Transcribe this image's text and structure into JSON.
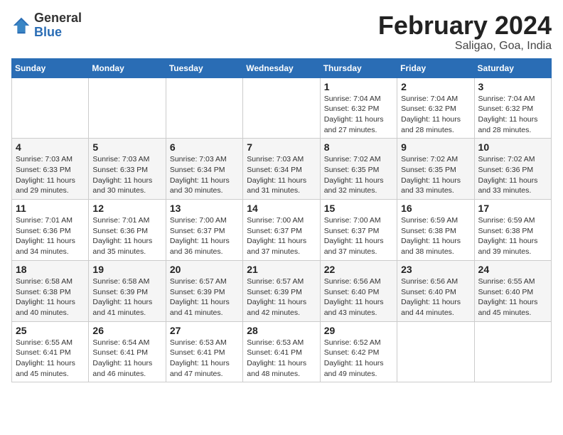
{
  "header": {
    "logo_general": "General",
    "logo_blue": "Blue",
    "month_title": "February 2024",
    "location": "Saligao, Goa, India"
  },
  "weekdays": [
    "Sunday",
    "Monday",
    "Tuesday",
    "Wednesday",
    "Thursday",
    "Friday",
    "Saturday"
  ],
  "weeks": [
    [
      {
        "day": "",
        "info": ""
      },
      {
        "day": "",
        "info": ""
      },
      {
        "day": "",
        "info": ""
      },
      {
        "day": "",
        "info": ""
      },
      {
        "day": "1",
        "info": "Sunrise: 7:04 AM\nSunset: 6:32 PM\nDaylight: 11 hours\nand 27 minutes."
      },
      {
        "day": "2",
        "info": "Sunrise: 7:04 AM\nSunset: 6:32 PM\nDaylight: 11 hours\nand 28 minutes."
      },
      {
        "day": "3",
        "info": "Sunrise: 7:04 AM\nSunset: 6:32 PM\nDaylight: 11 hours\nand 28 minutes."
      }
    ],
    [
      {
        "day": "4",
        "info": "Sunrise: 7:03 AM\nSunset: 6:33 PM\nDaylight: 11 hours\nand 29 minutes."
      },
      {
        "day": "5",
        "info": "Sunrise: 7:03 AM\nSunset: 6:33 PM\nDaylight: 11 hours\nand 30 minutes."
      },
      {
        "day": "6",
        "info": "Sunrise: 7:03 AM\nSunset: 6:34 PM\nDaylight: 11 hours\nand 30 minutes."
      },
      {
        "day": "7",
        "info": "Sunrise: 7:03 AM\nSunset: 6:34 PM\nDaylight: 11 hours\nand 31 minutes."
      },
      {
        "day": "8",
        "info": "Sunrise: 7:02 AM\nSunset: 6:35 PM\nDaylight: 11 hours\nand 32 minutes."
      },
      {
        "day": "9",
        "info": "Sunrise: 7:02 AM\nSunset: 6:35 PM\nDaylight: 11 hours\nand 33 minutes."
      },
      {
        "day": "10",
        "info": "Sunrise: 7:02 AM\nSunset: 6:36 PM\nDaylight: 11 hours\nand 33 minutes."
      }
    ],
    [
      {
        "day": "11",
        "info": "Sunrise: 7:01 AM\nSunset: 6:36 PM\nDaylight: 11 hours\nand 34 minutes."
      },
      {
        "day": "12",
        "info": "Sunrise: 7:01 AM\nSunset: 6:36 PM\nDaylight: 11 hours\nand 35 minutes."
      },
      {
        "day": "13",
        "info": "Sunrise: 7:00 AM\nSunset: 6:37 PM\nDaylight: 11 hours\nand 36 minutes."
      },
      {
        "day": "14",
        "info": "Sunrise: 7:00 AM\nSunset: 6:37 PM\nDaylight: 11 hours\nand 37 minutes."
      },
      {
        "day": "15",
        "info": "Sunrise: 7:00 AM\nSunset: 6:37 PM\nDaylight: 11 hours\nand 37 minutes."
      },
      {
        "day": "16",
        "info": "Sunrise: 6:59 AM\nSunset: 6:38 PM\nDaylight: 11 hours\nand 38 minutes."
      },
      {
        "day": "17",
        "info": "Sunrise: 6:59 AM\nSunset: 6:38 PM\nDaylight: 11 hours\nand 39 minutes."
      }
    ],
    [
      {
        "day": "18",
        "info": "Sunrise: 6:58 AM\nSunset: 6:38 PM\nDaylight: 11 hours\nand 40 minutes."
      },
      {
        "day": "19",
        "info": "Sunrise: 6:58 AM\nSunset: 6:39 PM\nDaylight: 11 hours\nand 41 minutes."
      },
      {
        "day": "20",
        "info": "Sunrise: 6:57 AM\nSunset: 6:39 PM\nDaylight: 11 hours\nand 41 minutes."
      },
      {
        "day": "21",
        "info": "Sunrise: 6:57 AM\nSunset: 6:39 PM\nDaylight: 11 hours\nand 42 minutes."
      },
      {
        "day": "22",
        "info": "Sunrise: 6:56 AM\nSunset: 6:40 PM\nDaylight: 11 hours\nand 43 minutes."
      },
      {
        "day": "23",
        "info": "Sunrise: 6:56 AM\nSunset: 6:40 PM\nDaylight: 11 hours\nand 44 minutes."
      },
      {
        "day": "24",
        "info": "Sunrise: 6:55 AM\nSunset: 6:40 PM\nDaylight: 11 hours\nand 45 minutes."
      }
    ],
    [
      {
        "day": "25",
        "info": "Sunrise: 6:55 AM\nSunset: 6:41 PM\nDaylight: 11 hours\nand 45 minutes."
      },
      {
        "day": "26",
        "info": "Sunrise: 6:54 AM\nSunset: 6:41 PM\nDaylight: 11 hours\nand 46 minutes."
      },
      {
        "day": "27",
        "info": "Sunrise: 6:53 AM\nSunset: 6:41 PM\nDaylight: 11 hours\nand 47 minutes."
      },
      {
        "day": "28",
        "info": "Sunrise: 6:53 AM\nSunset: 6:41 PM\nDaylight: 11 hours\nand 48 minutes."
      },
      {
        "day": "29",
        "info": "Sunrise: 6:52 AM\nSunset: 6:42 PM\nDaylight: 11 hours\nand 49 minutes."
      },
      {
        "day": "",
        "info": ""
      },
      {
        "day": "",
        "info": ""
      }
    ]
  ]
}
